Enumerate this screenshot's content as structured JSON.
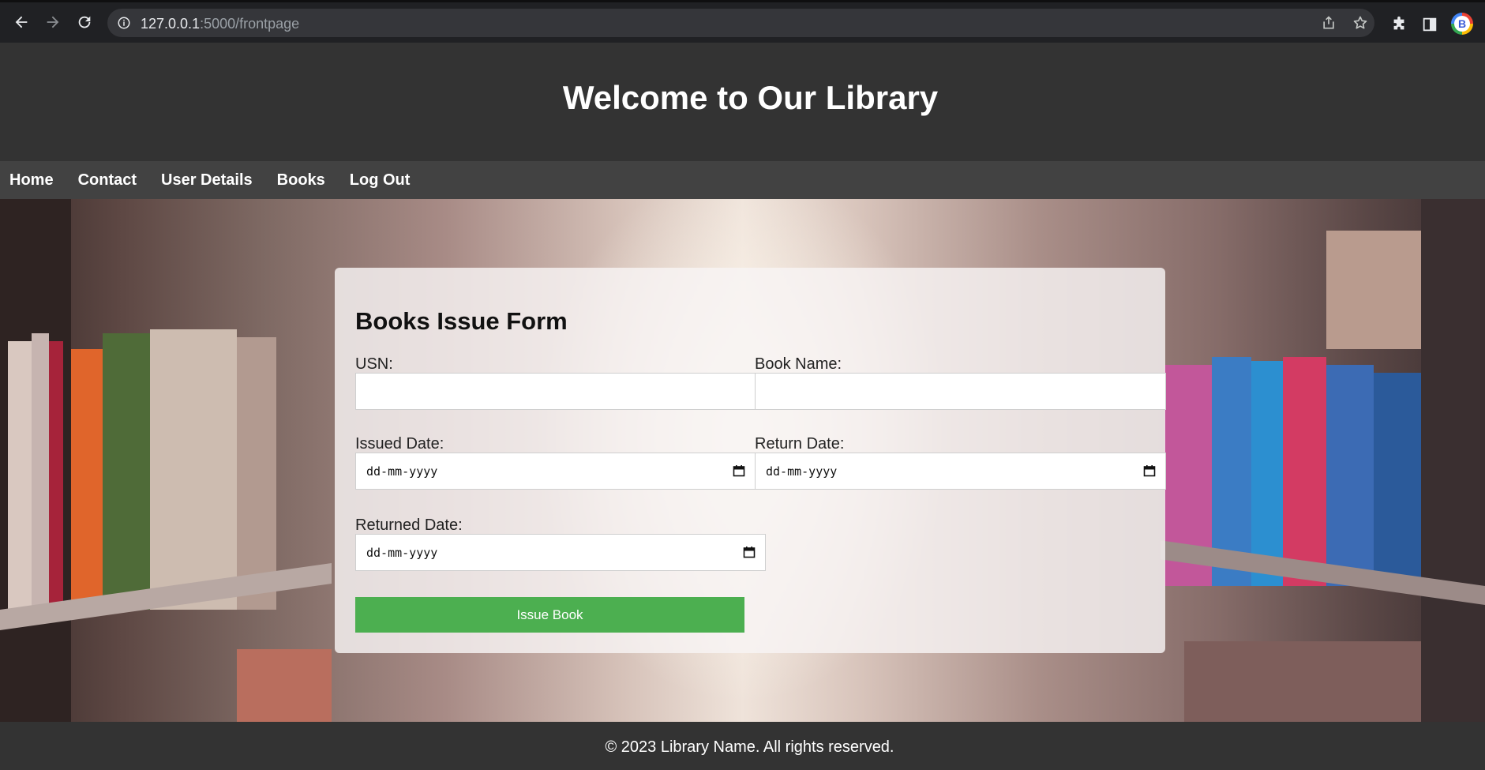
{
  "browser": {
    "url_host": "127.0.0.1",
    "url_path": ":5000/frontpage",
    "icons": [
      "back-arrow-icon",
      "forward-arrow-icon",
      "reload-icon",
      "info-icon",
      "share-icon",
      "star-icon",
      "puzzle-icon",
      "side-panel-icon",
      "profile-avatar"
    ]
  },
  "header": {
    "title": "Welcome to Our Library"
  },
  "nav": {
    "items": [
      {
        "label": "Home"
      },
      {
        "label": "Contact"
      },
      {
        "label": "User Details"
      },
      {
        "label": "Books"
      },
      {
        "label": "Log Out"
      }
    ]
  },
  "form": {
    "title": "Books Issue Form",
    "usn_label": "USN:",
    "usn_value": "",
    "book_name_label": "Book Name:",
    "book_name_value": "",
    "issued_date_label": "Issued Date:",
    "return_date_label": "Return Date:",
    "returned_date_label": "Returned Date:",
    "date_placeholder": "dd-mm-yyyy",
    "submit_label": "Issue Book"
  },
  "footer": {
    "text": "© 2023 Library Name. All rights reserved."
  },
  "colors": {
    "header_bg": "#333333",
    "nav_bg": "#424242",
    "button_bg": "#4caf50"
  }
}
